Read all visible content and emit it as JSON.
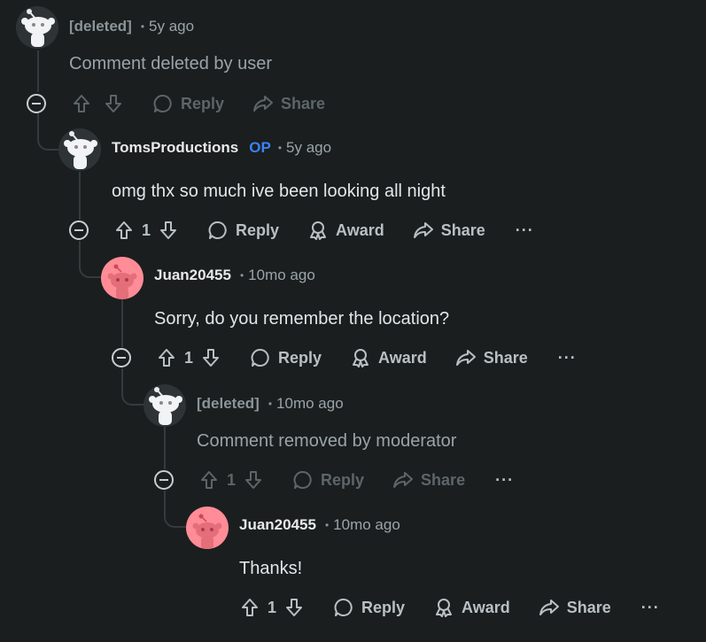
{
  "comments": [
    {
      "author": "[deleted]",
      "op_badge": "",
      "time": "5y ago",
      "body": "Comment deleted by user",
      "score": "",
      "actions": {
        "reply": "Reply",
        "share": "Share"
      }
    },
    {
      "author": "TomsProductions",
      "op_badge": "OP",
      "time": "5y ago",
      "body": "omg thx so much ive been looking all night",
      "score": "1",
      "actions": {
        "reply": "Reply",
        "award": "Award",
        "share": "Share",
        "more": "···"
      }
    },
    {
      "author": "Juan20455",
      "op_badge": "",
      "time": "10mo ago",
      "body": "Sorry, do you remember the location?",
      "score": "1",
      "actions": {
        "reply": "Reply",
        "award": "Award",
        "share": "Share",
        "more": "···"
      }
    },
    {
      "author": "[deleted]",
      "op_badge": "",
      "time": "10mo ago",
      "body": "Comment removed by moderator",
      "score": "1",
      "actions": {
        "reply": "Reply",
        "share": "Share",
        "more": "···"
      }
    },
    {
      "author": "Juan20455",
      "op_badge": "",
      "time": "10mo ago",
      "body": "Thanks!",
      "score": "1",
      "actions": {
        "reply": "Reply",
        "award": "Award",
        "share": "Share",
        "more": "···"
      }
    }
  ],
  "colors": {
    "background": "#1a1e1f",
    "op_badge": "#3b82f6",
    "avatar_pink": "#ff8c96",
    "avatar_grey": "#2e3436"
  },
  "icons": [
    "snoo-avatar-icon",
    "collapse-icon",
    "upvote-icon",
    "downvote-icon",
    "reply-icon",
    "award-icon",
    "share-icon",
    "more-icon"
  ]
}
